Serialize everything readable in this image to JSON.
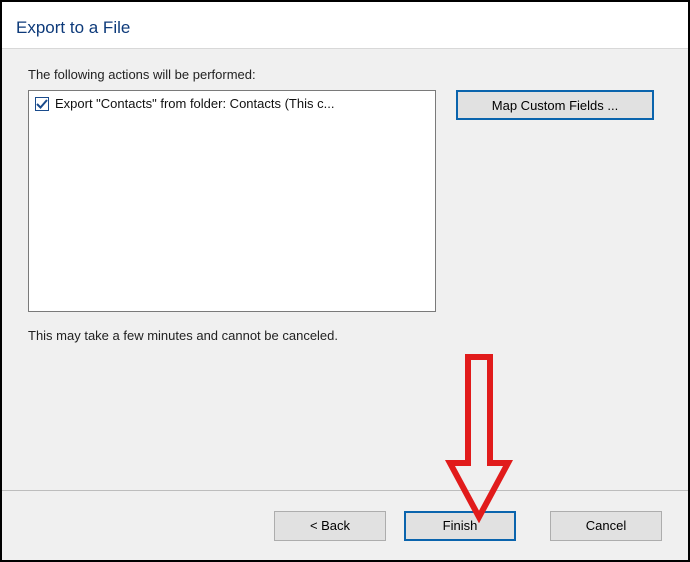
{
  "dialog": {
    "title": "Export to a File",
    "prompt": "The following actions will be performed:",
    "note": "This may take a few minutes and cannot be canceled."
  },
  "actions": {
    "items": [
      {
        "checked": true,
        "label": "Export \"Contacts\" from folder: Contacts (This c..."
      }
    ]
  },
  "side": {
    "map_custom_fields_label": "Map Custom Fields ..."
  },
  "buttons": {
    "back_label": "< Back",
    "finish_label": "Finish",
    "cancel_label": "Cancel"
  },
  "colors": {
    "title": "#0d3a7a",
    "focus_border": "#0a64ad",
    "panel_bg": "#f0f0f0"
  }
}
